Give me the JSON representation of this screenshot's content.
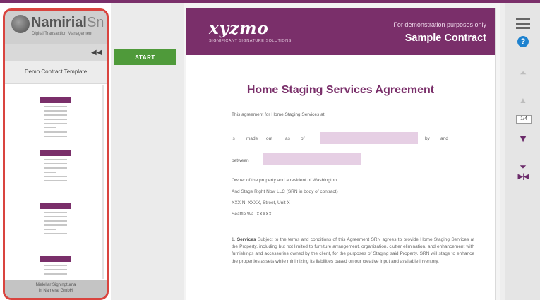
{
  "brand": {
    "name": "Namirial",
    "name_suffix": "Sn",
    "tagline": "Digital Transaction Management"
  },
  "sidebar": {
    "collapse_icon": "double-chevron-left-icon",
    "document_title": "Demo Contract Template",
    "footer_line1": "Nielellar Signingtuma",
    "footer_line2": "in Nameral GmbH"
  },
  "actions": {
    "start_label": "START"
  },
  "document": {
    "logo": "xyzmo",
    "logo_sub": "SIGNIFICANT SIGNATURE SOLUTIONS",
    "demo_note": "For demonstration purposes only",
    "header_title": "Sample Contract",
    "title": "Home Staging Services Agreement",
    "intro": "This agreement for Home Staging Services at",
    "made_words": [
      "is",
      "made",
      "out",
      "as",
      "of"
    ],
    "by_words": [
      "by",
      "and"
    ],
    "between_label": "between",
    "owner_lines": [
      "Owner of the property and a resident of Washington",
      "And Stage Right Now LLC (SRN in body of contract)",
      "XXX N. XXXX, Street, Unit X",
      "Seattle Wa. XXXXX"
    ],
    "section_number": "1.",
    "section_title": "Services",
    "section_text": "Subject to the terms and conditions of this Agreement SRN agrees to provide Home Staging Services at the Property, including but not limited to furniture arrangement, organization, clutter elimination, and enhancement with furnishings and accessories owned by the client, for the purposes of Staging said Property. SRN will stage to enhance the properties assets while minimizing its liabilities based on our creative input and available inventory."
  },
  "toolbar": {
    "menu_icon": "hamburger-menu-icon",
    "help_label": "?",
    "first_icon": "first-page-icon",
    "prev_icon": "previous-page-icon",
    "page_indicator": "1/4",
    "next_icon": "next-page-icon",
    "last_icon": "last-page-icon",
    "fit_icon": "fit-width-icon"
  },
  "colors": {
    "accent": "#7a2f6a",
    "start": "#4f9a3a",
    "field": "#e6cfe4",
    "help": "#1e82cf",
    "highlight_border": "#d9443f"
  }
}
